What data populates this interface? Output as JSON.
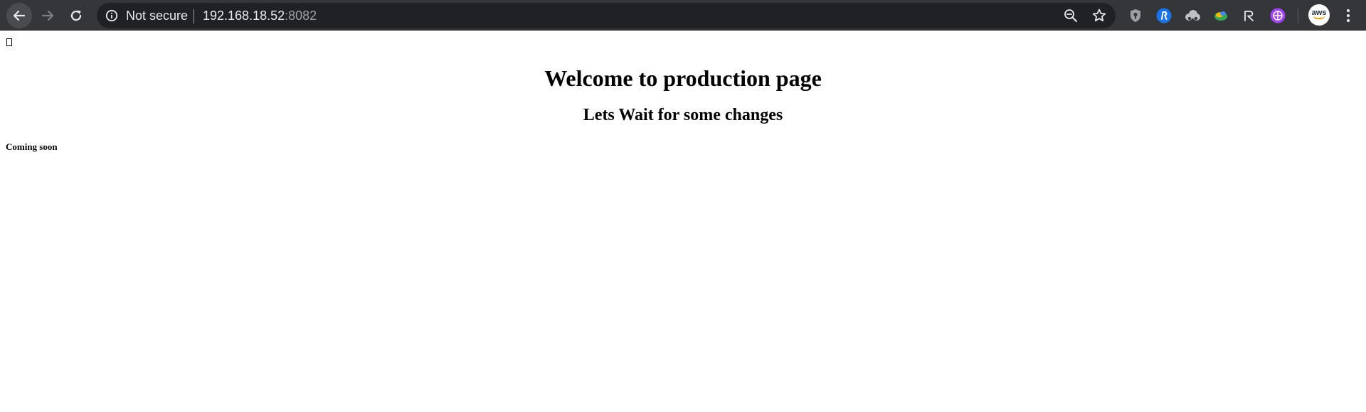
{
  "browser": {
    "nav": {
      "back_icon": "arrow-left-icon",
      "forward_icon": "arrow-right-icon",
      "reload_icon": "reload-icon"
    },
    "omnibox": {
      "security_icon": "info-icon",
      "security_label": "Not secure",
      "url_host": "192.168.18.52",
      "url_port": ":8082",
      "zoom_icon": "zoom-icon",
      "bookmark_icon": "star-icon"
    },
    "extensions": [
      {
        "icon": "bitwarden-shield-icon",
        "color": "#9aa0a6"
      },
      {
        "icon": "rakuten-r-icon",
        "color": "#1a73e8"
      },
      {
        "icon": "cloud-icon",
        "color": "#bdc1c6"
      },
      {
        "icon": "green-swirl-icon",
        "color": "#34a853"
      },
      {
        "icon": "r-letter-icon",
        "color": "#e8eaed"
      },
      {
        "icon": "purple-globe-icon",
        "color": "#a142f4"
      }
    ],
    "profile": {
      "avatar_text": "aws",
      "accent": "#ff9900"
    },
    "menu_icon": "more-vertical-icon",
    "colors": {
      "toolbar": "#35363a",
      "omnibox": "#202124",
      "text": "#e8eaed",
      "muted": "#9aa0a6"
    }
  },
  "page": {
    "heading": "Welcome to production page",
    "subheading": "Lets Wait for some changes",
    "note": "Coming soon",
    "broken_image_icon": "missing-glyph-icon"
  }
}
